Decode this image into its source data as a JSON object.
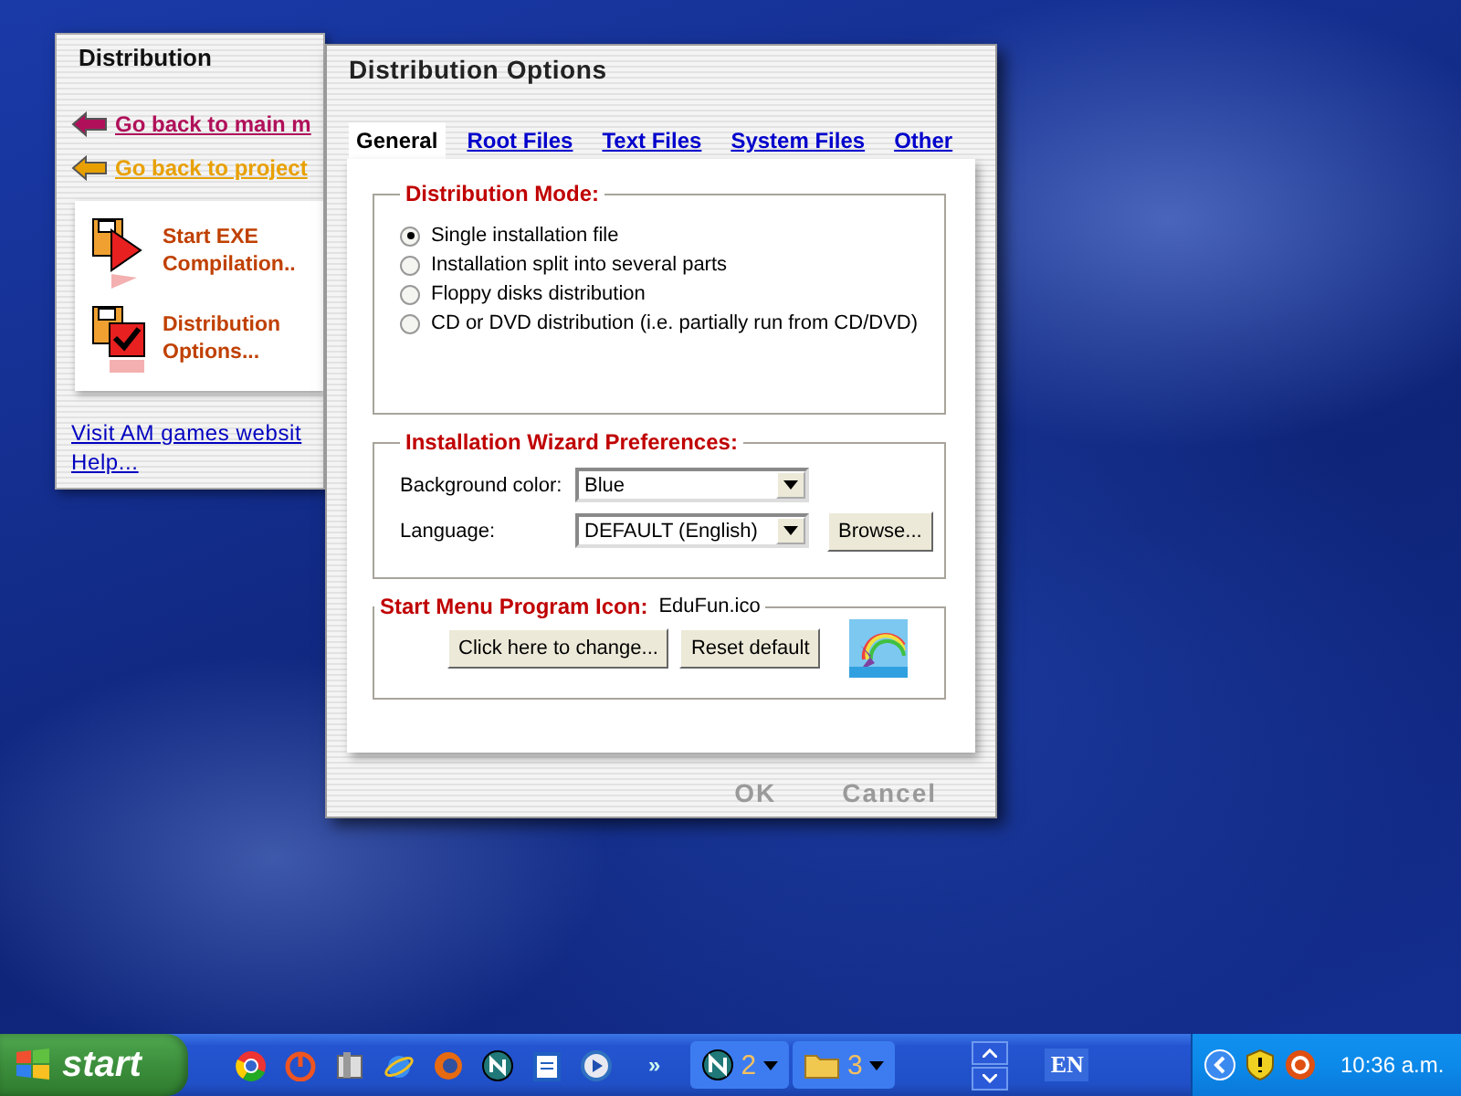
{
  "back_window": {
    "title": "Distribution",
    "links": [
      {
        "text": "Go back to main m",
        "color": "#b0105a"
      },
      {
        "text": "Go back to project",
        "color": "#e8a000"
      }
    ],
    "actions": [
      {
        "text": "Start EXE Compilation..",
        "kind": "compile"
      },
      {
        "text": "Distribution Options...",
        "kind": "options"
      }
    ],
    "footer_links": [
      "Visit AM games websit",
      "Help..."
    ]
  },
  "dialog": {
    "title": "Distribution Options",
    "tabs": [
      {
        "label": "General",
        "selected": true
      },
      {
        "label": "Root Files",
        "selected": false
      },
      {
        "label": "Text Files",
        "selected": false
      },
      {
        "label": "System Files",
        "selected": false
      },
      {
        "label": "Other",
        "selected": false
      }
    ],
    "distribution_mode": {
      "legend": "Distribution Mode:",
      "options": [
        {
          "label": "Single installation file",
          "selected": true
        },
        {
          "label": "Installation split into several parts",
          "selected": false
        },
        {
          "label": "Floppy disks distribution",
          "selected": false
        },
        {
          "label": "CD or DVD distribution (i.e. partially run from CD/DVD)",
          "selected": false
        }
      ]
    },
    "wizard": {
      "legend": "Installation Wizard Preferences:",
      "background_color": {
        "label": "Background color:",
        "value": "Blue"
      },
      "language": {
        "label": "Language:",
        "value": "DEFAULT (English)"
      },
      "browse": "Browse..."
    },
    "icon_group": {
      "legend": "Start Menu Program Icon:",
      "file": "EduFun.ico",
      "buttons": [
        "Click here to change...",
        "Reset default"
      ]
    },
    "buttons": [
      {
        "label": "OK",
        "disabled": true
      },
      {
        "label": "Cancel",
        "disabled": true
      }
    ]
  },
  "taskbar": {
    "start": "start",
    "chevron": "»",
    "groups": [
      {
        "kind": "browser",
        "count": "2"
      },
      {
        "kind": "folder",
        "count": "3"
      }
    ],
    "language": "EN",
    "clock": "10:36 a.m."
  }
}
